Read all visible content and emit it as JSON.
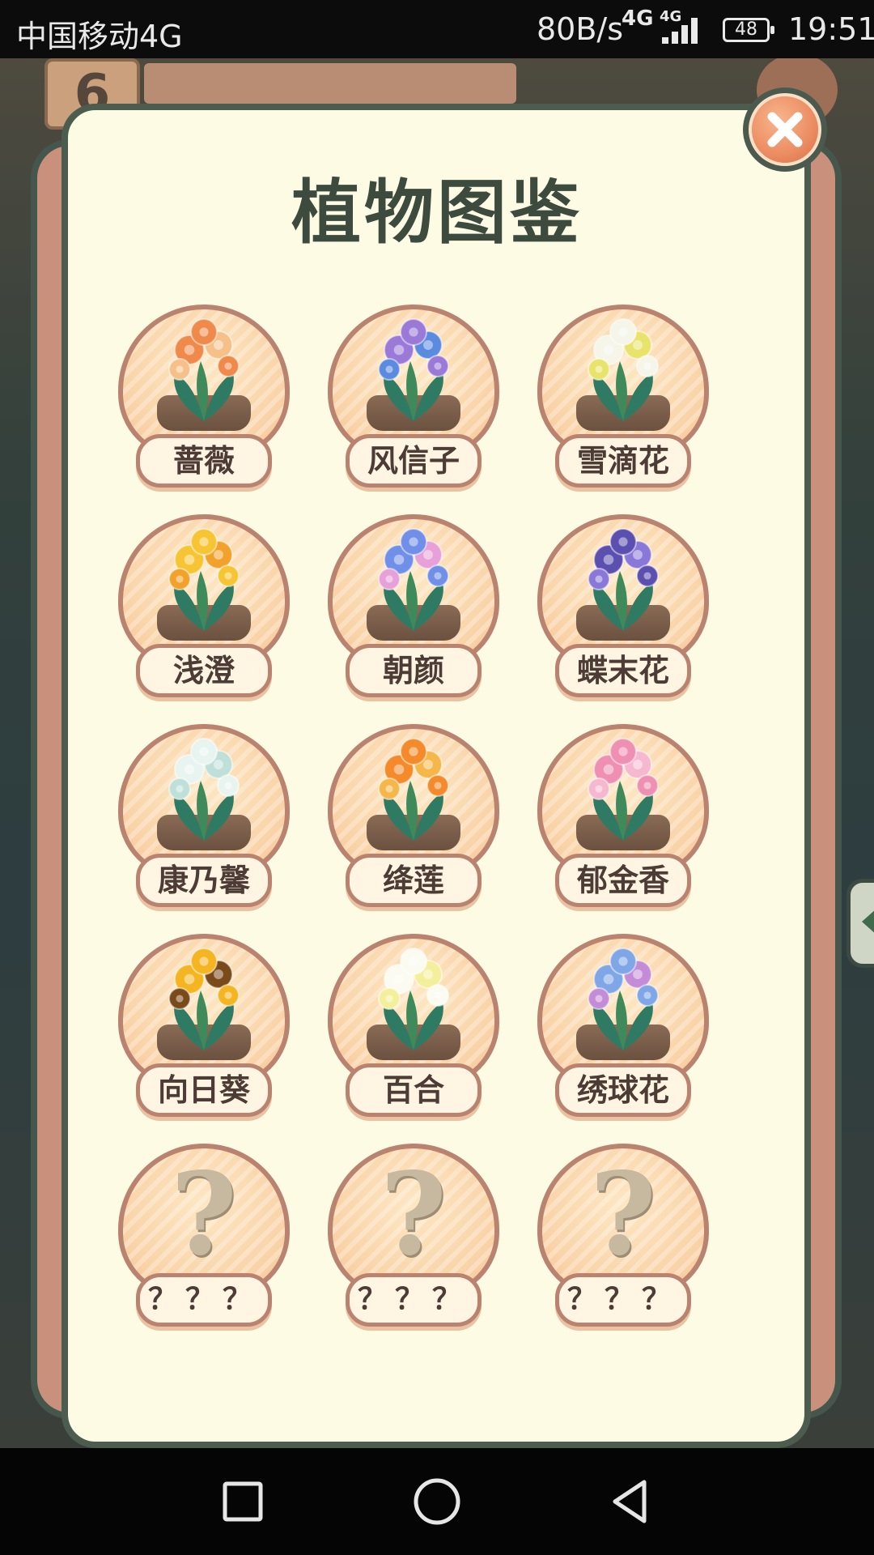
{
  "status_bar": {
    "carrier": "中国移动4G",
    "speed": "80B/s",
    "network_type": "4G",
    "network_type_small": "4G",
    "battery": "48",
    "time": "19:51"
  },
  "background": {
    "level_number": "6"
  },
  "panel": {
    "title": "植物图鉴",
    "close_icon": "close-icon"
  },
  "plants": [
    {
      "name": "蔷薇",
      "icon": "rose-plant-icon",
      "colors": [
        "#f08a4a",
        "#f6c089"
      ],
      "locked": false
    },
    {
      "name": "风信子",
      "icon": "hyacinth-plant-icon",
      "colors": [
        "#9a79d8",
        "#5a8be0"
      ],
      "locked": false
    },
    {
      "name": "雪滴花",
      "icon": "snowdrop-plant-icon",
      "colors": [
        "#f5f5ea",
        "#e8e36a"
      ],
      "locked": false
    },
    {
      "name": "浅澄",
      "icon": "yellow-flower-plant-icon",
      "colors": [
        "#f7c534",
        "#f2a12a"
      ],
      "locked": false
    },
    {
      "name": "朝颜",
      "icon": "morning-glory-plant-icon",
      "colors": [
        "#6f8fe8",
        "#e8a0d8"
      ],
      "locked": false
    },
    {
      "name": "蝶末花",
      "icon": "iris-plant-icon",
      "colors": [
        "#5b4fb0",
        "#8a78d8"
      ],
      "locked": false
    },
    {
      "name": "康乃馨",
      "icon": "carnation-plant-icon",
      "colors": [
        "#e8f4f0",
        "#bfe0d8"
      ],
      "locked": false
    },
    {
      "name": "绛莲",
      "icon": "orange-lily-plant-icon",
      "colors": [
        "#f58a2a",
        "#f6b74a"
      ],
      "locked": false
    },
    {
      "name": "郁金香",
      "icon": "tulip-plant-icon",
      "colors": [
        "#ef8fb2",
        "#f6b8cf"
      ],
      "locked": false
    },
    {
      "name": "向日葵",
      "icon": "sunflower-plant-icon",
      "colors": [
        "#f4b521",
        "#7a4a1a"
      ],
      "locked": false
    },
    {
      "name": "百合",
      "icon": "lily-plant-icon",
      "colors": [
        "#fbfbf2",
        "#f4ef9a"
      ],
      "locked": false
    },
    {
      "name": "绣球花",
      "icon": "hydrangea-plant-icon",
      "colors": [
        "#7fa6e6",
        "#c48cd6"
      ],
      "locked": false
    },
    {
      "name": "？？？",
      "icon": "question-mark-icon",
      "locked": true
    },
    {
      "name": "？？？",
      "icon": "question-mark-icon",
      "locked": true
    },
    {
      "name": "？？？",
      "icon": "question-mark-icon",
      "locked": true
    }
  ],
  "nav_bar": {
    "recent_icon": "square-icon",
    "home_icon": "circle-icon",
    "back_icon": "triangle-back-icon"
  }
}
